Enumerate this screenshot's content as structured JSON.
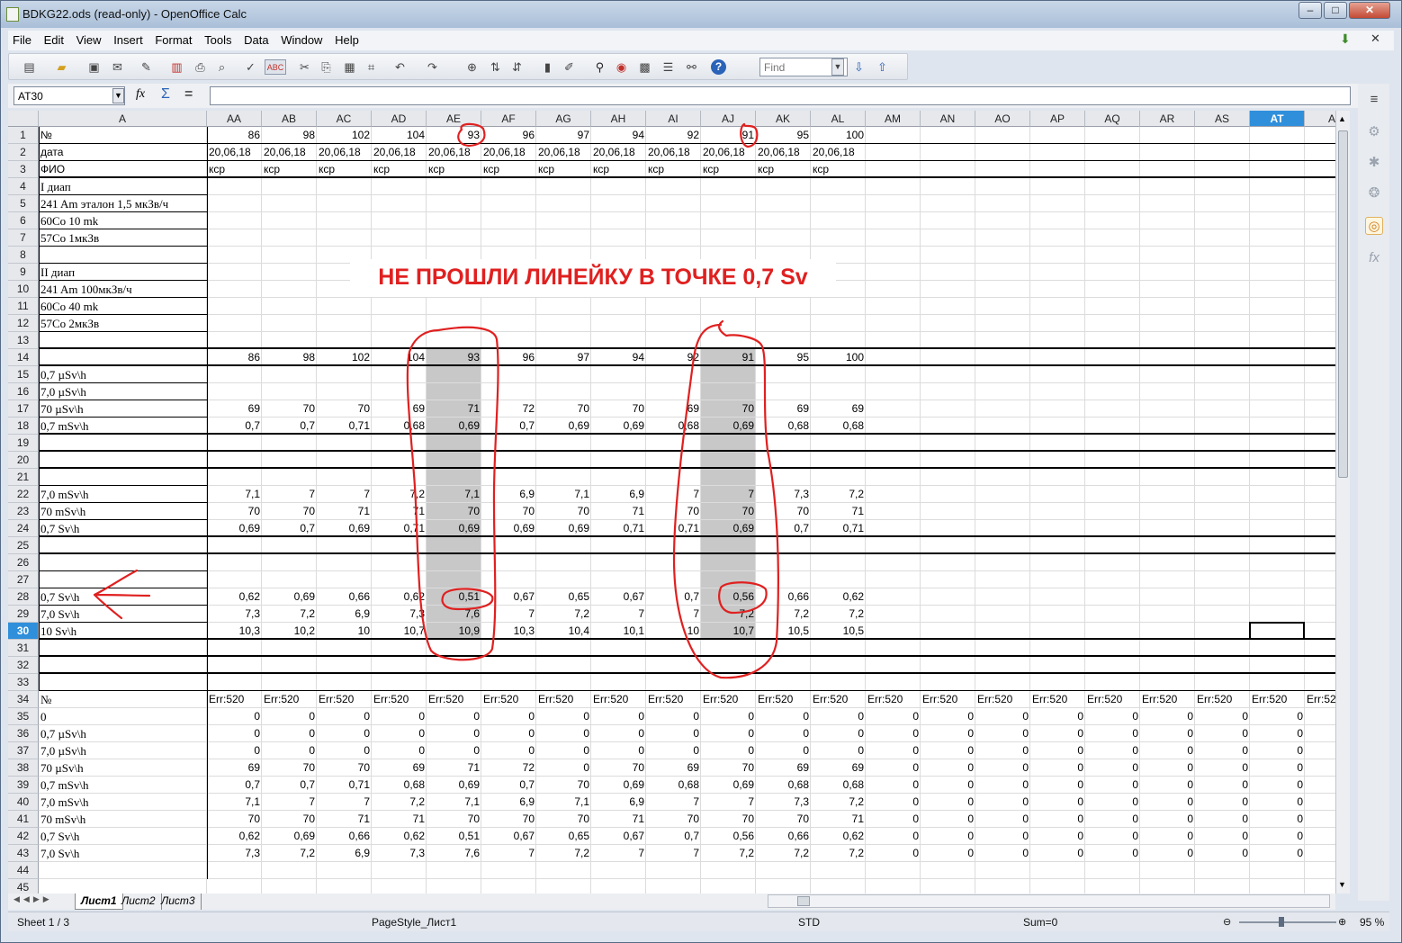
{
  "window": {
    "title": "BDKG22.ods (read-only) - OpenOffice Calc",
    "min": "–",
    "max": "□",
    "close": "✕"
  },
  "menu": [
    "File",
    "Edit",
    "View",
    "Insert",
    "Format",
    "Tools",
    "Data",
    "Window",
    "Help"
  ],
  "toolbar": {
    "find_placeholder": "Find"
  },
  "formula": {
    "cell_ref": "AT30",
    "func_icon": "fx",
    "sum_icon": "Σ",
    "equals": "="
  },
  "columns": [
    "A",
    "AA",
    "AB",
    "AC",
    "AD",
    "AE",
    "AF",
    "AG",
    "AH",
    "AI",
    "AJ",
    "AK",
    "AL",
    "AM",
    "AN",
    "AO",
    "AP",
    "AQ",
    "AR",
    "AS",
    "AT",
    "A"
  ],
  "selected_column": "AT",
  "selected_row": "30",
  "col_a_labels": {
    "1": "№",
    "2": "дата",
    "3": "ФИО",
    "4": "I диап",
    "5": "241 Am эталон 1,5 мкЗв/ч",
    "6": "60Co 10 mk",
    "7": "57Co 1мкЗв",
    "9": "II диап",
    "10": "241 Am 100мкЗв/ч",
    "11": "60Co 40 mk",
    "12": "57Co 2мкЗв",
    "15": "0,7  µSv\\h",
    "16": "7,0  µSv\\h",
    "17": "70 µSv\\h",
    "18": "0,7 mSv\\h",
    "22": "7,0 mSv\\h",
    "23": "70  mSv\\h",
    "24": "0,7 Sv\\h",
    "28": "0,7 Sv\\h",
    "29": "7,0   Sv\\h",
    "30": "10 Sv\\h",
    "34": "№",
    "35": "0",
    "36": "0,7  µSv\\h",
    "37": "7,0  µSv\\h",
    "38": "70 µSv\\h",
    "39": "0,7 mSv\\h",
    "40": "7,0 mSv\\h",
    "41": "70  mSv\\h",
    "42": "0,7 Sv\\h",
    "43": "7,0  Sv\\h"
  },
  "data_rows": {
    "1": [
      "86",
      "98",
      "102",
      "104",
      "93",
      "96",
      "97",
      "94",
      "92",
      "91",
      "95",
      "100"
    ],
    "2": [
      "20,06,18",
      "20,06,18",
      "20,06,18",
      "20,06,18",
      "20,06,18",
      "20,06,18",
      "20,06,18",
      "20,06,18",
      "20,06,18",
      "20,06,18",
      "20,06,18",
      "20,06,18"
    ],
    "3": [
      "кср",
      "кср",
      "кср",
      "кср",
      "кср",
      "кср",
      "кср",
      "кср",
      "кср",
      "кср",
      "кср",
      "кср"
    ],
    "14": [
      "86",
      "98",
      "102",
      "104",
      "93",
      "96",
      "97",
      "94",
      "92",
      "91",
      "95",
      "100"
    ],
    "17": [
      "69",
      "70",
      "70",
      "69",
      "71",
      "72",
      "70",
      "70",
      "69",
      "70",
      "69",
      "69"
    ],
    "18": [
      "0,7",
      "0,7",
      "0,71",
      "0,68",
      "0,69",
      "0,7",
      "0,69",
      "0,69",
      "0,68",
      "0,69",
      "0,68",
      "0,68"
    ],
    "22": [
      "7,1",
      "7",
      "7",
      "7,2",
      "7,1",
      "6,9",
      "7,1",
      "6,9",
      "7",
      "7",
      "7,3",
      "7,2"
    ],
    "23": [
      "70",
      "70",
      "71",
      "71",
      "70",
      "70",
      "70",
      "71",
      "70",
      "70",
      "70",
      "71"
    ],
    "24": [
      "0,69",
      "0,7",
      "0,69",
      "0,71",
      "0,69",
      "0,69",
      "0,69",
      "0,71",
      "0,71",
      "0,69",
      "0,7",
      "0,71"
    ],
    "28": [
      "0,62",
      "0,69",
      "0,66",
      "0,62",
      "0,51",
      "0,67",
      "0,65",
      "0,67",
      "0,7",
      "0,56",
      "0,66",
      "0,62"
    ],
    "29": [
      "7,3",
      "7,2",
      "6,9",
      "7,3",
      "7,6",
      "7",
      "7,2",
      "7",
      "7",
      "7,2",
      "7,2",
      "7,2"
    ],
    "30": [
      "10,3",
      "10,2",
      "10",
      "10,7",
      "10,9",
      "10,3",
      "10,4",
      "10,1",
      "10",
      "10,7",
      "10,5",
      "10,5"
    ],
    "34": [
      "Err:520",
      "Err:520",
      "Err:520",
      "Err:520",
      "Err:520",
      "Err:520",
      "Err:520",
      "Err:520",
      "Err:520",
      "Err:520",
      "Err:520",
      "Err:520",
      "Err:520",
      "Err:520",
      "Err:520",
      "Err:520",
      "Err:520",
      "Err:520",
      "Err:520",
      "Err:520",
      "Err:52"
    ],
    "35": [
      "0",
      "0",
      "0",
      "0",
      "0",
      "0",
      "0",
      "0",
      "0",
      "0",
      "0",
      "0",
      "0",
      "0",
      "0",
      "0",
      "0",
      "0",
      "0",
      "0"
    ],
    "36": [
      "0",
      "0",
      "0",
      "0",
      "0",
      "0",
      "0",
      "0",
      "0",
      "0",
      "0",
      "0",
      "0",
      "0",
      "0",
      "0",
      "0",
      "0",
      "0",
      "0"
    ],
    "37": [
      "0",
      "0",
      "0",
      "0",
      "0",
      "0",
      "0",
      "0",
      "0",
      "0",
      "0",
      "0",
      "0",
      "0",
      "0",
      "0",
      "0",
      "0",
      "0",
      "0"
    ],
    "38": [
      "69",
      "70",
      "70",
      "69",
      "71",
      "72",
      "0",
      "70",
      "69",
      "70",
      "69",
      "69",
      "0",
      "0",
      "0",
      "0",
      "0",
      "0",
      "0",
      "0"
    ],
    "39": [
      "0,7",
      "0,7",
      "0,71",
      "0,68",
      "0,69",
      "0,7",
      "70",
      "0,69",
      "0,68",
      "0,69",
      "0,68",
      "0,68",
      "0",
      "0",
      "0",
      "0",
      "0",
      "0",
      "0",
      "0"
    ],
    "40": [
      "7,1",
      "7",
      "7",
      "7,2",
      "7,1",
      "6,9",
      "7,1",
      "6,9",
      "7",
      "7",
      "7,3",
      "7,2",
      "0",
      "0",
      "0",
      "0",
      "0",
      "0",
      "0",
      "0"
    ],
    "41": [
      "70",
      "70",
      "71",
      "71",
      "70",
      "70",
      "70",
      "71",
      "70",
      "70",
      "70",
      "71",
      "0",
      "0",
      "0",
      "0",
      "0",
      "0",
      "0",
      "0"
    ],
    "42": [
      "0,62",
      "0,69",
      "0,66",
      "0,62",
      "0,51",
      "0,67",
      "0,65",
      "0,67",
      "0,7",
      "0,56",
      "0,66",
      "0,62",
      "0",
      "0",
      "0",
      "0",
      "0",
      "0",
      "0",
      "0"
    ],
    "43": [
      "7,3",
      "7,2",
      "6,9",
      "7,3",
      "7,6",
      "7",
      "7,2",
      "7",
      "7",
      "7,2",
      "7,2",
      "7,2",
      "0",
      "0",
      "0",
      "0",
      "0",
      "0",
      "0",
      "0"
    ]
  },
  "tabs": [
    "Лист1",
    "Лист2",
    "Лист3"
  ],
  "status": {
    "sheet": "Sheet 1 / 3",
    "page_style": "PageStyle_Лист1",
    "mode": "STD",
    "sum": "Sum=0",
    "zoom": "95 %"
  },
  "annotation": {
    "callout": "НЕ ПРОШЛИ ЛИНЕЙКУ В ТОЧКЕ 0,7 Sv",
    "color": "#e02020"
  },
  "colors": {
    "selection": "#2f8fdb",
    "shade": "#c8c8c8"
  }
}
